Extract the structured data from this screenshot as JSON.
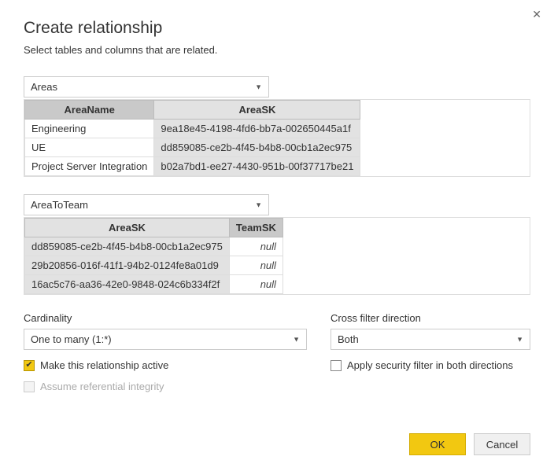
{
  "dialog": {
    "title": "Create relationship",
    "subtitle": "Select tables and columns that are related."
  },
  "table1": {
    "name": "Areas",
    "columns": [
      "AreaName",
      "AreaSK"
    ],
    "selectedCol": 1,
    "rows": [
      [
        "Engineering",
        "9ea18e45-4198-4fd6-bb7a-002650445a1f"
      ],
      [
        "UE",
        "dd859085-ce2b-4f45-b4b8-00cb1a2ec975"
      ],
      [
        "Project Server Integration",
        "b02a7bd1-ee27-4430-951b-00f37717be21"
      ]
    ]
  },
  "table2": {
    "name": "AreaToTeam",
    "columns": [
      "AreaSK",
      "TeamSK"
    ],
    "selectedCol": 0,
    "rows": [
      [
        "dd859085-ce2b-4f45-b4b8-00cb1a2ec975",
        "null"
      ],
      [
        "29b20856-016f-41f1-94b2-0124fe8a01d9",
        "null"
      ],
      [
        "16ac5c76-aa36-42e0-9848-024c6b334f2f",
        "null"
      ]
    ]
  },
  "options": {
    "cardinality_label": "Cardinality",
    "cardinality_value": "One to many (1:*)",
    "crossfilter_label": "Cross filter direction",
    "crossfilter_value": "Both",
    "active_label": "Make this relationship active",
    "integrity_label": "Assume referential integrity",
    "security_label": "Apply security filter in both directions"
  },
  "buttons": {
    "ok": "OK",
    "cancel": "Cancel"
  }
}
